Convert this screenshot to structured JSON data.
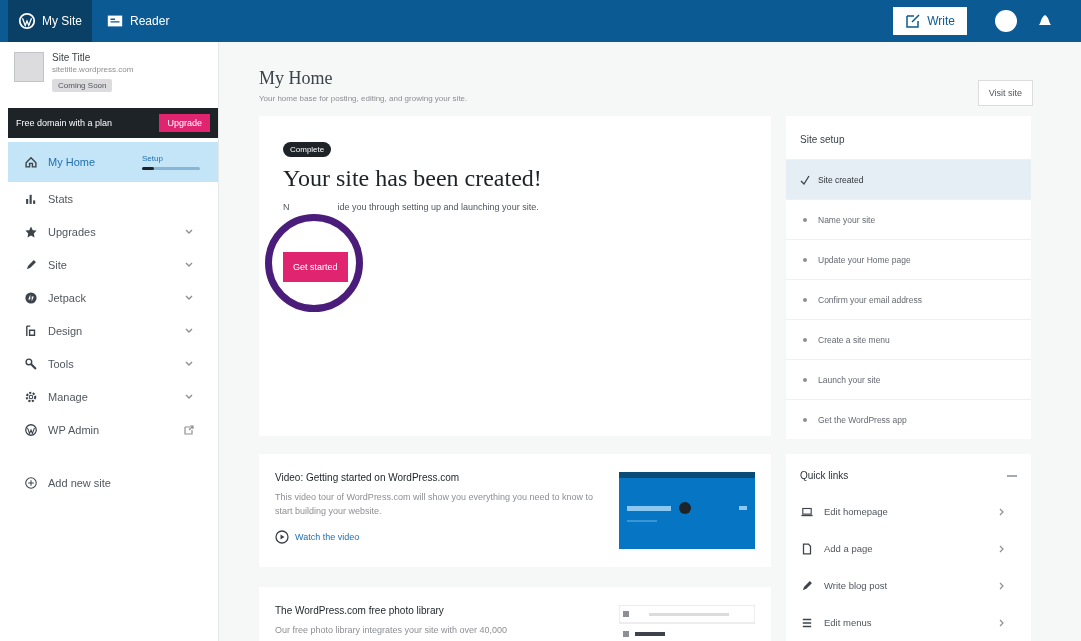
{
  "topbar": {
    "tabs": [
      {
        "label": "My Site",
        "kind": "site",
        "selected": true
      },
      {
        "label": "Reader",
        "kind": "reader",
        "selected": false
      }
    ],
    "write_button": "Write"
  },
  "sidebar": {
    "site": {
      "title": "Site Title",
      "url": "sitetitle.wordpress.com",
      "badge": "Coming Soon"
    },
    "banner": {
      "text": "Free domain with a plan",
      "button": "Upgrade"
    },
    "items": [
      {
        "label": "My Home",
        "selected": true,
        "progress": {
          "label": "Setup",
          "level": 0.2
        }
      },
      {
        "label": "Stats",
        "selected": false
      },
      {
        "label": "Upgrades",
        "selected": false,
        "expandable": true
      },
      {
        "label": "Site",
        "selected": false,
        "expandable": true
      },
      {
        "label": "Jetpack",
        "selected": false,
        "expandable": true
      },
      {
        "label": "Design",
        "selected": false,
        "expandable": true
      },
      {
        "label": "Tools",
        "selected": false,
        "expandable": true
      },
      {
        "label": "Manage",
        "selected": false,
        "expandable": true
      },
      {
        "label": "WP Admin",
        "selected": false,
        "external": true
      }
    ],
    "add_site": "Add new site"
  },
  "header": {
    "title": "My Home",
    "subtitle": "Your home base for posting, editing, and growing your site.",
    "visit_button": "Visit site"
  },
  "hero": {
    "badge": "Complete",
    "title": "Your site has been created!",
    "text_start": "N",
    "text_end": "ide you through setting up and launching your site.",
    "button": "Get started"
  },
  "site_setup": {
    "title": "Site setup",
    "steps": [
      {
        "label": "Site created",
        "done": true,
        "selected": true
      },
      {
        "label": "Name your site",
        "done": false,
        "selected": false
      },
      {
        "label": "Update your Home page",
        "done": false,
        "selected": false
      },
      {
        "label": "Confirm your email address",
        "done": false,
        "selected": false
      },
      {
        "label": "Create a site menu",
        "done": false,
        "selected": false
      },
      {
        "label": "Launch your site",
        "done": false,
        "selected": false
      },
      {
        "label": "Get the WordPress app",
        "done": false,
        "selected": false
      }
    ]
  },
  "cards": [
    {
      "kind": "video",
      "title": "Video: Getting started on WordPress.com",
      "text": "This video tour of WordPress.com will show you everything you need to know to start building your website.",
      "link": "Watch the video"
    },
    {
      "kind": "photos",
      "title": "The WordPress.com free photo library",
      "text": "Our free photo library integrates your site with over 40,000"
    }
  ],
  "quick_links": {
    "title": "Quick links",
    "items": [
      {
        "label": "Edit homepage"
      },
      {
        "label": "Add a page"
      },
      {
        "label": "Write blog post"
      },
      {
        "label": "Edit menus"
      }
    ]
  }
}
